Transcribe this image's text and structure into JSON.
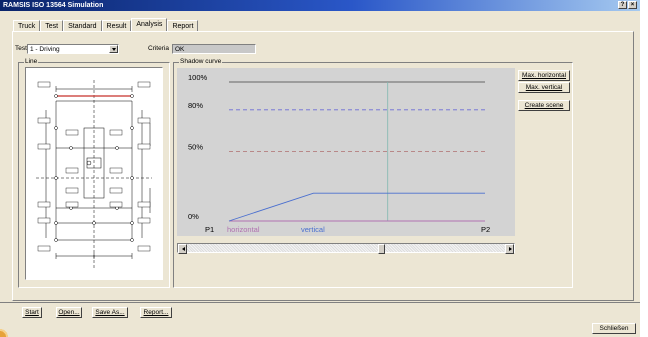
{
  "window": {
    "title": "RAMSIS ISO 13564 Simulation",
    "help_label": "?",
    "close_label": "×"
  },
  "tabs": [
    {
      "label": "Truck"
    },
    {
      "label": "Test"
    },
    {
      "label": "Standard"
    },
    {
      "label": "Result"
    },
    {
      "label": "Analysis"
    },
    {
      "label": "Report"
    }
  ],
  "active_tab": "Analysis",
  "test": {
    "label": "Test",
    "value": "1 - Driving"
  },
  "criteria": {
    "label": "Criteria",
    "value": "OK"
  },
  "line_group": {
    "label": "Line"
  },
  "shadow_group": {
    "label": "Shadow curve"
  },
  "chart_data": {
    "type": "line",
    "y_labels": [
      "100%",
      "80%",
      "50%",
      "0%"
    ],
    "x_labels": {
      "start": "P1",
      "end": "P2"
    },
    "ylim": [
      0,
      100
    ],
    "series": [
      {
        "name": "horizontal",
        "color": "#b070b0",
        "x": [
          0,
          1
        ],
        "y": [
          0,
          0
        ]
      },
      {
        "name": "vertical",
        "color": "#4a6fcf",
        "x": [
          0,
          0.33,
          1
        ],
        "y": [
          0,
          20,
          20
        ]
      }
    ],
    "threshold_lines": [
      {
        "y": 100,
        "style": "solid",
        "color": "#404040"
      },
      {
        "y": 80,
        "style": "dashed",
        "color": "#6b6bd6"
      },
      {
        "y": 50,
        "style": "dashed",
        "color": "#b07070"
      }
    ],
    "marker_x": 0.62,
    "marker_color": "#80b8b0"
  },
  "scrollbar": {
    "position": 0.61
  },
  "side_buttons": {
    "max_horizontal": "Max. horizontal",
    "max_vertical": "Max. vertical",
    "create_scene": "Create scene"
  },
  "bottom_buttons": {
    "start": "Start",
    "open": "Open...",
    "save_as": "Save As...",
    "report": "Report...",
    "close": "Schließen"
  },
  "colors": {
    "title_gradient_start": "#0a246a",
    "title_gradient_end": "#a6caf0",
    "window_bg": "#ece6d4"
  }
}
